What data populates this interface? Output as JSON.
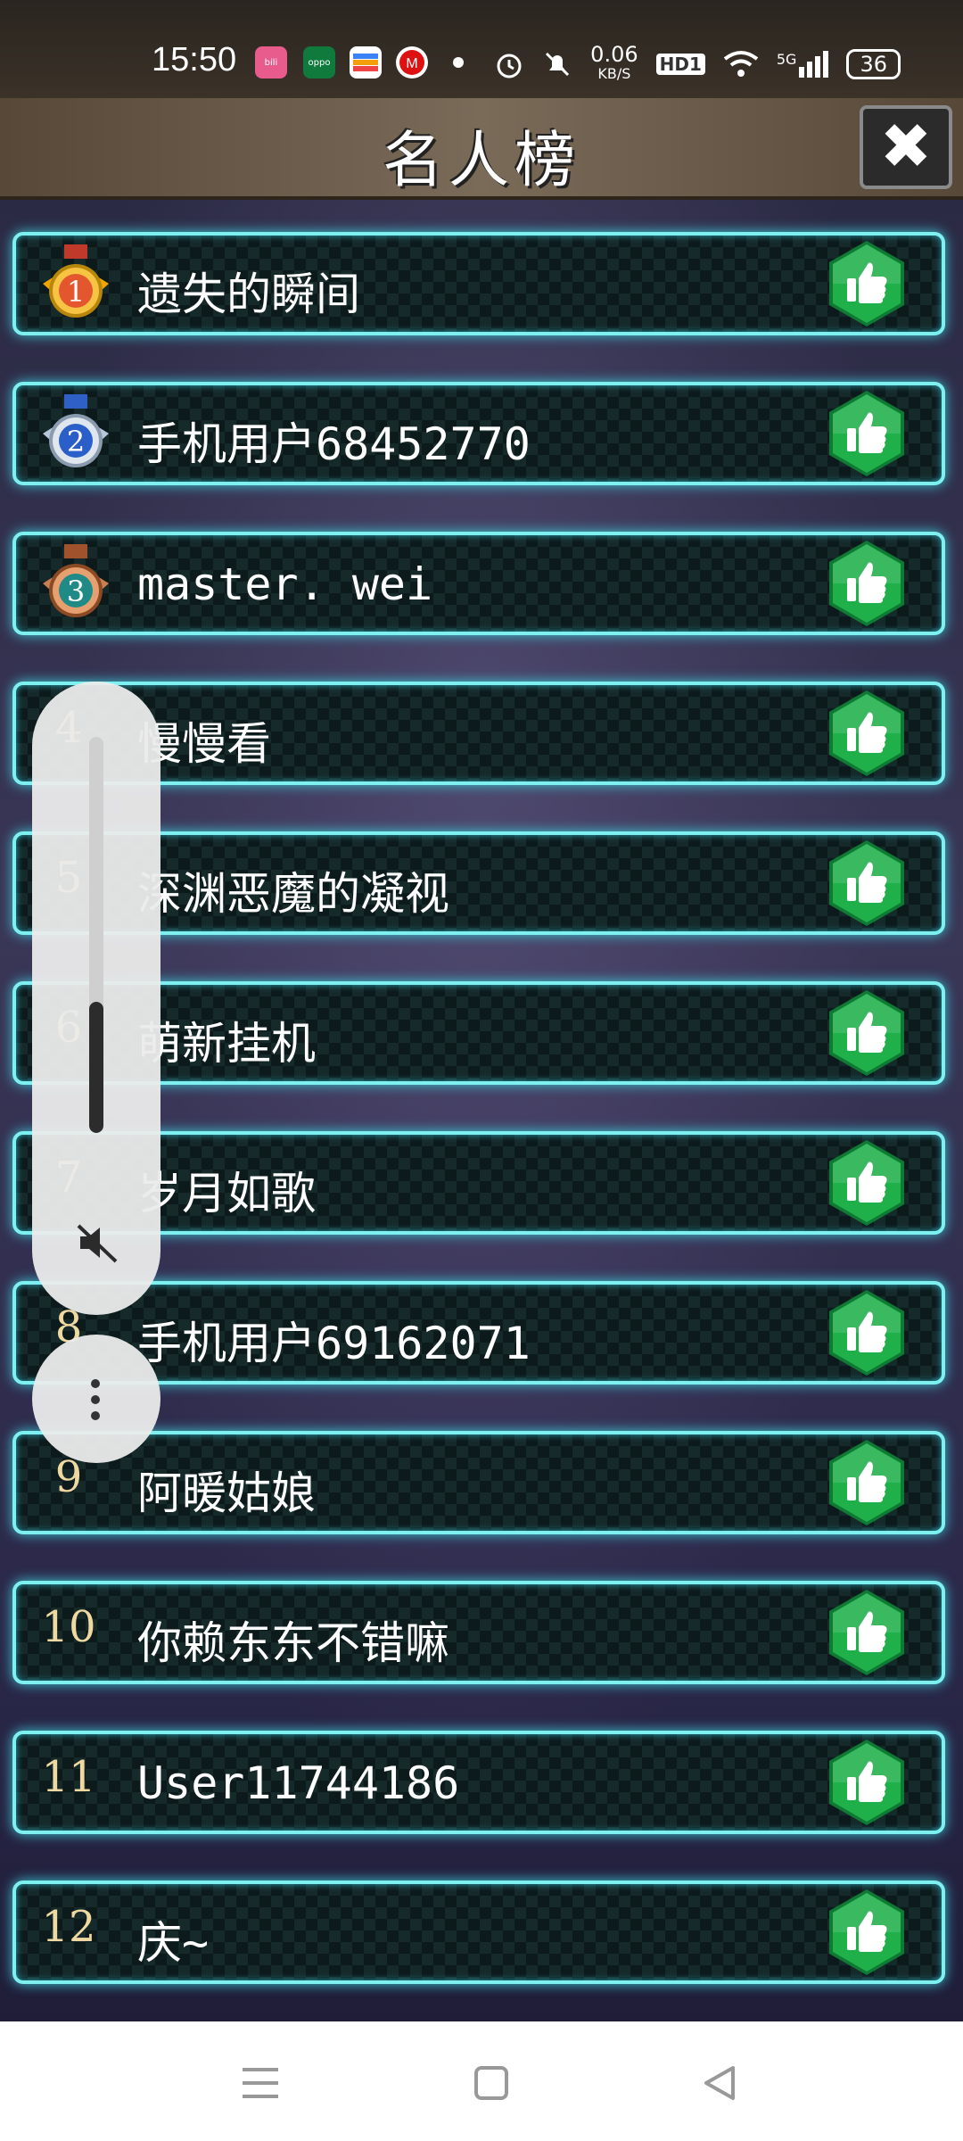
{
  "status_bar": {
    "time": "15:50",
    "apps": [
      "bilibili-icon",
      "oppo-icon",
      "wallet-icon",
      "metro-icon"
    ],
    "net_speed": "0.06",
    "net_unit": "KB/S",
    "hd": "HD1",
    "signal": "5G",
    "battery": "36"
  },
  "header": {
    "title": "名人榜",
    "close_label": "✖"
  },
  "leaderboard": [
    {
      "rank": "1",
      "name": "遗失的瞬间",
      "medal": "gold"
    },
    {
      "rank": "2",
      "name": "手机用户68452770",
      "medal": "silver"
    },
    {
      "rank": "3",
      "name": "master. wei",
      "medal": "bronze"
    },
    {
      "rank": "4",
      "name": "慢慢看"
    },
    {
      "rank": "5",
      "name": "深渊恶魔的凝视"
    },
    {
      "rank": "6",
      "name": "萌新挂机"
    },
    {
      "rank": "7",
      "name": "岁月如歌"
    },
    {
      "rank": "8",
      "name": "手机用户69162071"
    },
    {
      "rank": "9",
      "name": "阿暖姑娘"
    },
    {
      "rank": "10",
      "name": "你赖东东不错嘛"
    },
    {
      "rank": "11",
      "name": "User11744186"
    },
    {
      "rank": "12",
      "name": "庆~"
    }
  ],
  "volume": {
    "level": 0.33
  },
  "colors": {
    "row_border": "#7ff0f0",
    "like_green": "#1fb04a",
    "rank_text": "#f0d9a0"
  },
  "icons": {
    "like": "thumbs-up-icon",
    "close": "close-icon",
    "mute": "speaker-mute-icon",
    "nav": [
      "menu-icon",
      "home-icon",
      "back-icon"
    ]
  }
}
